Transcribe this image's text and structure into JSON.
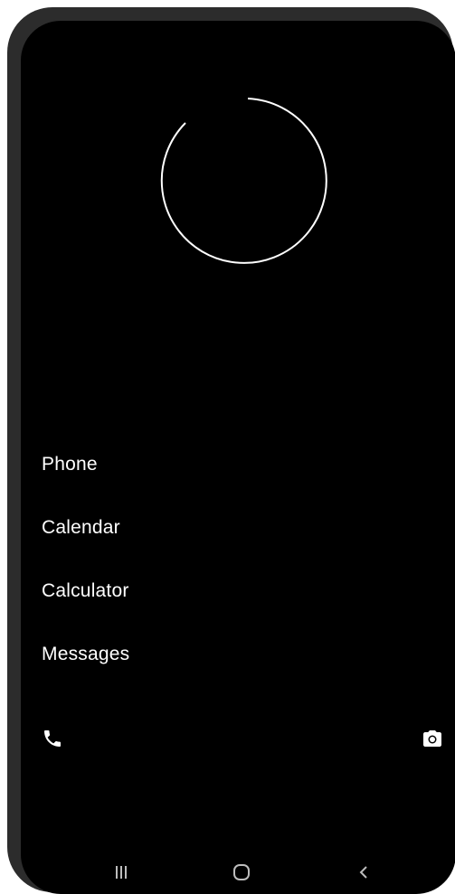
{
  "screen": {
    "background": "#000000",
    "loading_indicator": {
      "icon": "progress-ring",
      "color": "#ffffff"
    }
  },
  "app_list": {
    "items": [
      {
        "label": "Phone"
      },
      {
        "label": "Calendar"
      },
      {
        "label": "Calculator"
      },
      {
        "label": "Messages"
      }
    ]
  },
  "shortcuts": {
    "left_icon": "phone-icon",
    "right_icon": "camera-icon"
  },
  "nav_bar": {
    "recents_icon": "recents-icon",
    "home_icon": "home-icon",
    "back_icon": "back-icon"
  }
}
